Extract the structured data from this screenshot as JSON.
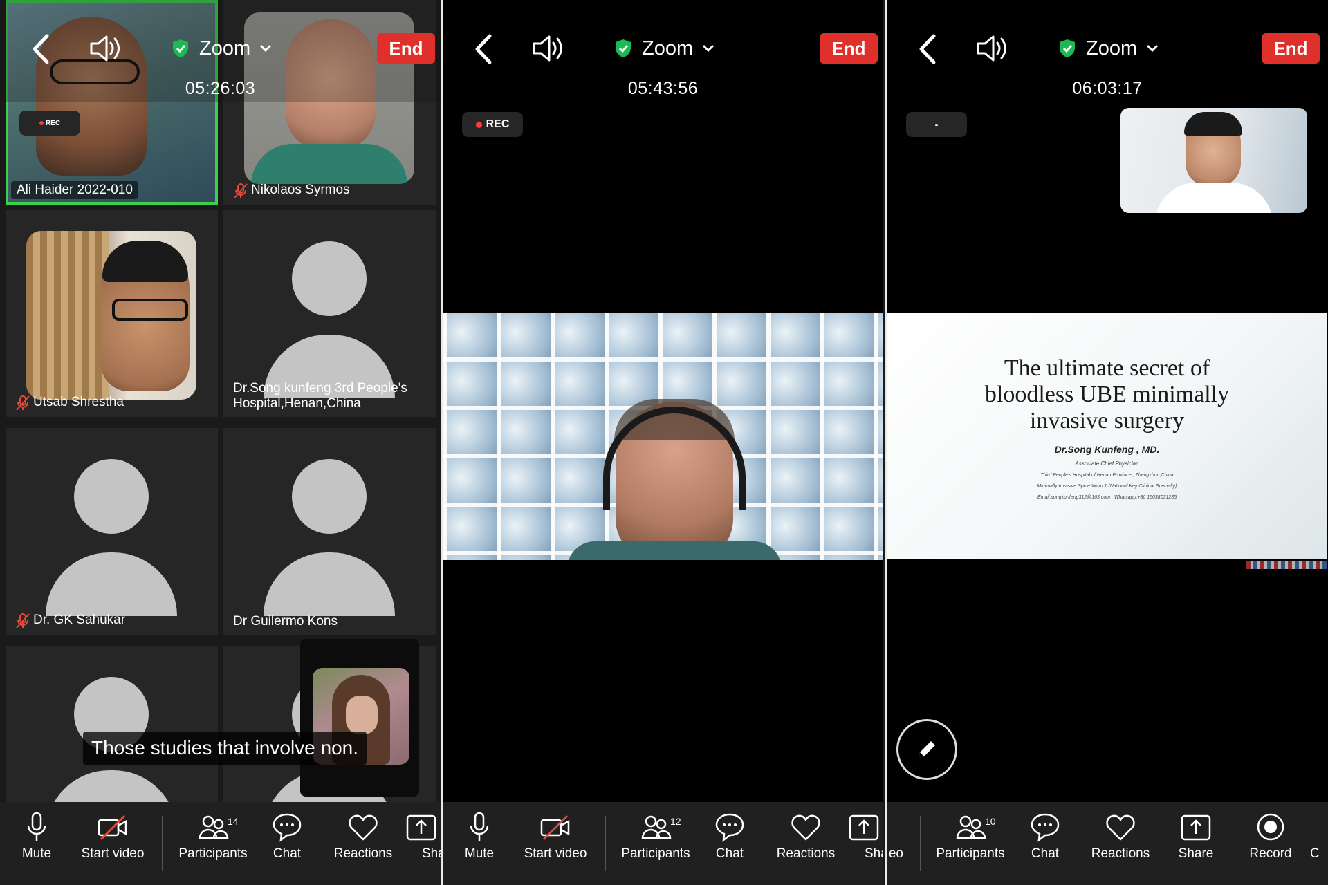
{
  "panels": [
    {
      "app_title": "Zoom",
      "end_label": "End",
      "timer": "05:26:03",
      "rec_label": "REC",
      "tiles": [
        {
          "name": "Ali Haider 2022-010"
        },
        {
          "name": "Nikolaos Syrmos"
        },
        {
          "name": "Utsab Shrestha"
        },
        {
          "name_line1": "Dr.Song kunfeng 3rd People's",
          "name_line2": "Hospital,Henan,China"
        },
        {
          "name": "Dr. GK Sahukar"
        },
        {
          "name": "Dr Guilermo Kons"
        }
      ],
      "caption": "Those studies that involve non.",
      "toolbar": {
        "mute": "Mute",
        "start_video": "Start video",
        "participants": "Participants",
        "participants_count": "14",
        "chat": "Chat",
        "reactions": "Reactions",
        "share_partial": "Sha"
      }
    },
    {
      "app_title": "Zoom",
      "end_label": "End",
      "timer": "05:43:56",
      "rec_label": "REC",
      "toolbar": {
        "mute": "Mute",
        "start_video": "Start video",
        "participants": "Participants",
        "participants_count": "12",
        "chat": "Chat",
        "reactions": "Reactions",
        "share_partial": "Sha"
      }
    },
    {
      "app_title": "Zoom",
      "end_label": "End",
      "timer": "06:03:17",
      "rec_label": "-",
      "slide": {
        "title_line1": "The ultimate secret of",
        "title_line2": "bloodless UBE minimally",
        "title_line3": "invasive surgery",
        "author": "Dr.Song Kunfeng , MD.",
        "role": "Associate Chief Physician",
        "line1": "Third People's Hospital of Henan Province , Zhengzhou,China",
        "line2": "Minimally Invasive Spine Ward 1 (National Key Clinical Specialty)",
        "line3": "Email:songkunfeng312@163.com , Whatsapp:+86 15038031235"
      },
      "toolbar": {
        "video_partial": "eo",
        "participants": "Participants",
        "participants_count": "10",
        "chat": "Chat",
        "reactions": "Reactions",
        "share": "Share",
        "record": "Record",
        "more_partial": "C"
      }
    }
  ],
  "colors": {
    "end_button": "#e0302b",
    "shield_green": "#1db954",
    "rec_dot": "#ff3b3b",
    "active_speaker_border": "#3ecf4c"
  },
  "icons": [
    "back-arrow-icon",
    "speaker-icon",
    "shield-check-icon",
    "chevron-down-icon",
    "microphone-icon",
    "video-off-icon",
    "participants-icon",
    "chat-icon",
    "heart-icon",
    "share-icon",
    "record-icon",
    "pencil-icon",
    "mic-muted-icon"
  ]
}
